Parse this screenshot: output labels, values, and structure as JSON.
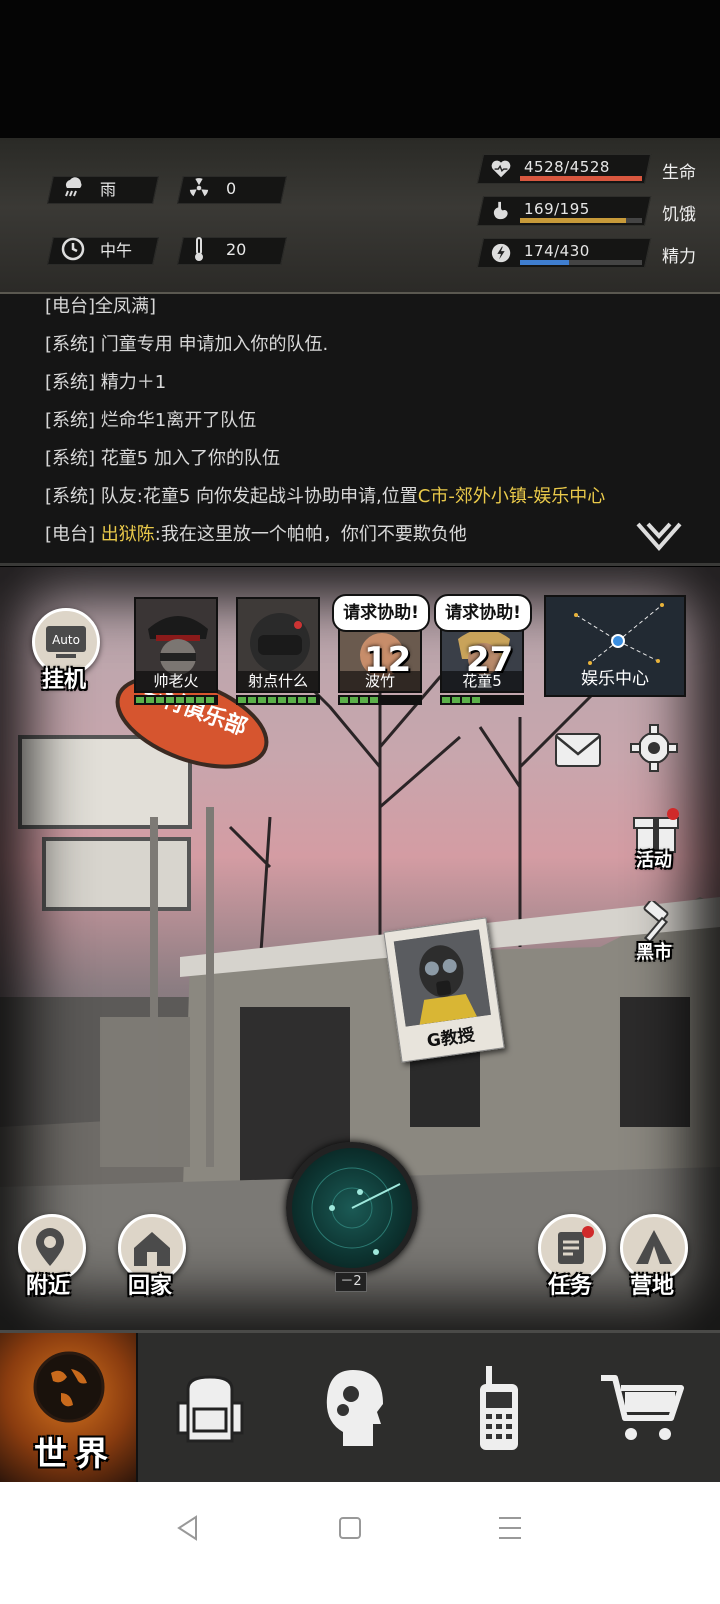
{
  "status": {
    "weather_label": "雨",
    "radiation_value": "0",
    "time_label": "中午",
    "temperature_value": "20"
  },
  "vitals": {
    "health": {
      "value": "4528/4528",
      "label": "生命",
      "fraction": 1.0,
      "color": "#d8573f"
    },
    "hunger": {
      "value": "169/195",
      "label": "饥饿",
      "fraction": 0.87,
      "color": "#c79a3a"
    },
    "energy": {
      "value": "174/430",
      "label": "精力",
      "fraction": 0.4,
      "color": "#3f7ed0"
    }
  },
  "chat": {
    "lines": [
      {
        "tag": "[电台]",
        "text": "全凤满]",
        "highlight": ""
      },
      {
        "tag": "[系统]",
        "text": "门童专用 申请加入你的队伍.",
        "highlight": ""
      },
      {
        "tag": "[系统]",
        "text": "精力＋1",
        "highlight": ""
      },
      {
        "tag": "[系统]",
        "text": "烂命华1离开了队伍",
        "highlight": ""
      },
      {
        "tag": "[系统]",
        "text": "花童5 加入了你的队伍",
        "highlight": ""
      },
      {
        "tag": "[系统]",
        "text": "队友:花童5 向你发起战斗协助申请,位置",
        "highlight": "C市-郊外小镇-娱乐中心"
      },
      {
        "tag": "[电台]",
        "text": ":我在这里放一个帕帕，你们不要欺负他",
        "highlight_prefix": "出狱陈"
      }
    ]
  },
  "scene": {
    "auto_label": "挂机",
    "auto_icon_text": "Auto",
    "team": [
      {
        "name": "帅老火",
        "hp": 8
      },
      {
        "name": "射点什么",
        "hp": 8
      },
      {
        "name": "波竹",
        "hp": 4,
        "help": "请求协助!",
        "count": "12"
      },
      {
        "name": "花童5",
        "hp": 4,
        "help": "请求协助!",
        "count": "27"
      }
    ],
    "map_label": "娱乐中心",
    "activity_label": "活动",
    "black_market_label": "黑市",
    "npc_name": "G教授",
    "radar_level": "－2",
    "nearby_label": "附近",
    "home_label": "回家",
    "task_label": "任务",
    "camp_label": "营地",
    "sign_text": "乡村俱乐部"
  },
  "nav": {
    "world_label": "世界"
  }
}
